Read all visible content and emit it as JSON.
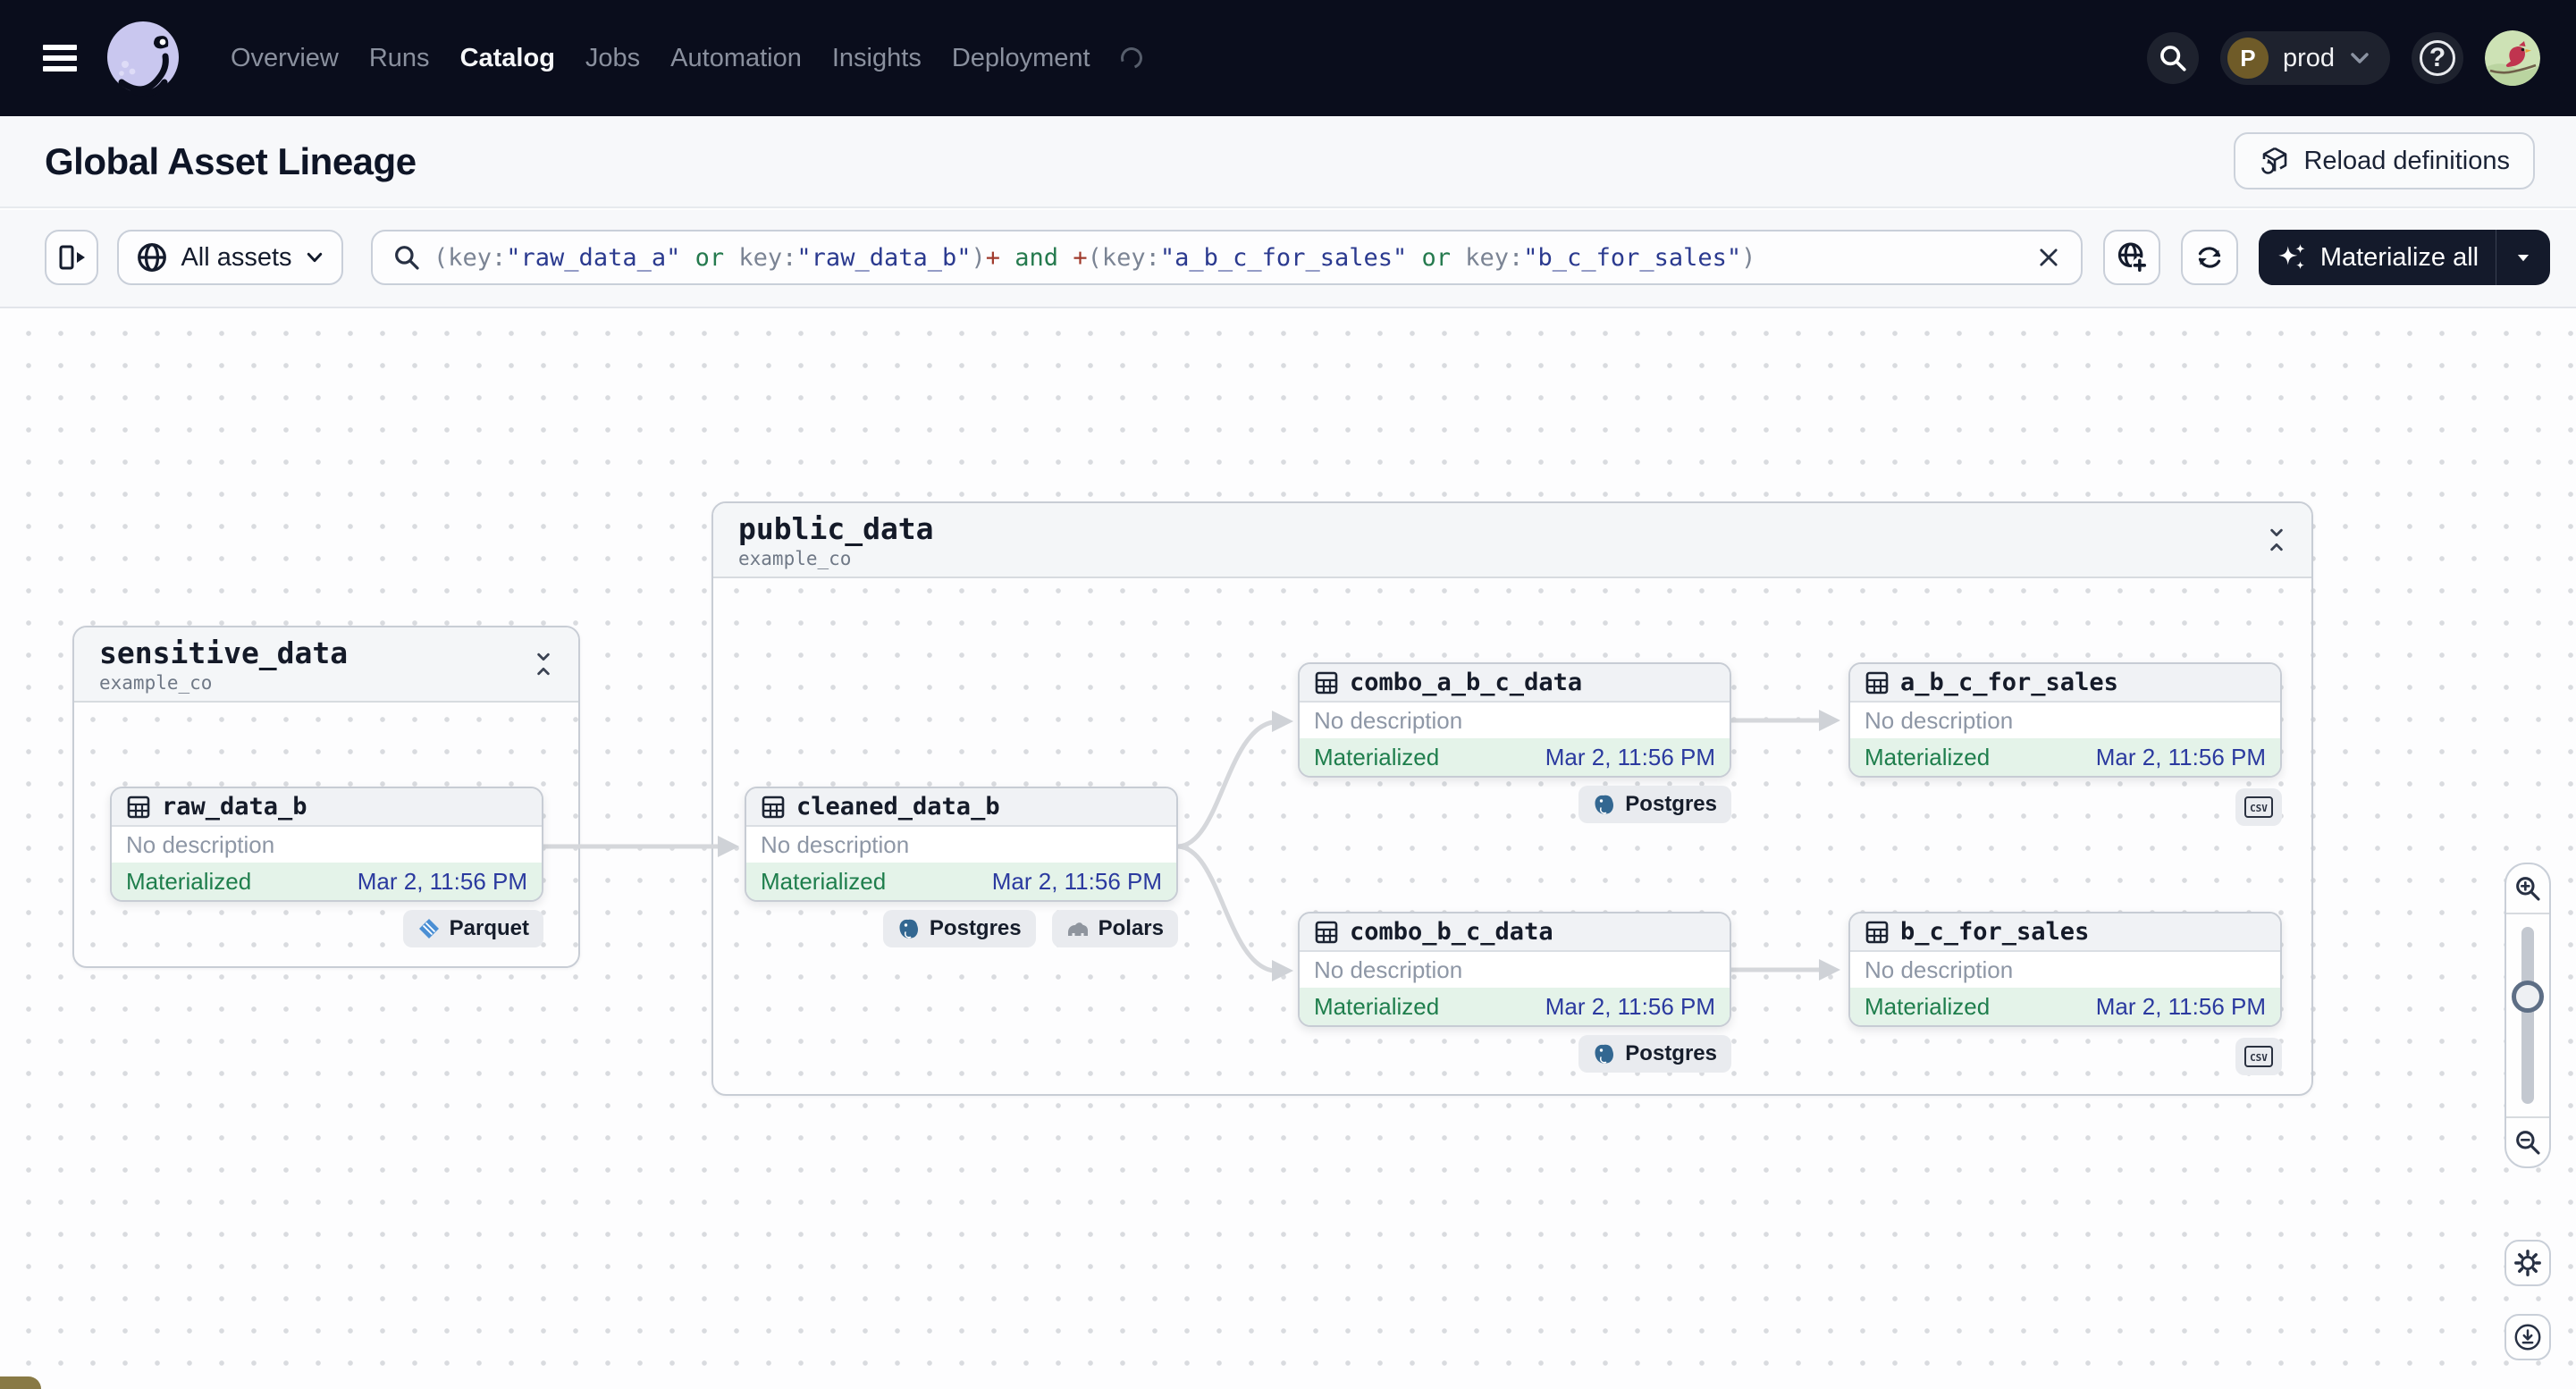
{
  "nav": {
    "items": [
      {
        "label": "Overview",
        "active": false
      },
      {
        "label": "Runs",
        "active": false
      },
      {
        "label": "Catalog",
        "active": true
      },
      {
        "label": "Jobs",
        "active": false
      },
      {
        "label": "Automation",
        "active": false
      },
      {
        "label": "Insights",
        "active": false
      },
      {
        "label": "Deployment",
        "active": false
      }
    ],
    "workspace": {
      "initial": "P",
      "name": "prod"
    },
    "help_glyph": "?"
  },
  "header": {
    "title": "Global Asset Lineage",
    "reload_button": "Reload definitions"
  },
  "toolbar": {
    "scope": {
      "label": "All assets"
    },
    "search": {
      "segments": [
        {
          "t": "(key:",
          "c": "q-p"
        },
        {
          "t": "\"raw_data_a\"",
          "c": "q-s"
        },
        {
          "t": " ",
          "c": "q-p"
        },
        {
          "t": "or",
          "c": "q-o"
        },
        {
          "t": " key:",
          "c": "q-p"
        },
        {
          "t": "\"raw_data_b\"",
          "c": "q-s"
        },
        {
          "t": ")",
          "c": "q-p"
        },
        {
          "t": "+",
          "c": "q-m"
        },
        {
          "t": " ",
          "c": "q-p"
        },
        {
          "t": "and",
          "c": "q-o"
        },
        {
          "t": " ",
          "c": "q-p"
        },
        {
          "t": "+",
          "c": "q-m"
        },
        {
          "t": "(key:",
          "c": "q-p"
        },
        {
          "t": "\"a_b_c_for_sales\"",
          "c": "q-s"
        },
        {
          "t": " ",
          "c": "q-p"
        },
        {
          "t": "or",
          "c": "q-o"
        },
        {
          "t": " key:",
          "c": "q-p"
        },
        {
          "t": "\"b_c_for_sales\"",
          "c": "q-s"
        },
        {
          "t": ")",
          "c": "q-p"
        }
      ]
    },
    "materialize": {
      "label": "Materialize all"
    }
  },
  "graph": {
    "groups": [
      {
        "name": "sensitive_data",
        "repo": "example_co"
      },
      {
        "name": "public_data",
        "repo": "example_co"
      }
    ],
    "nodes": [
      {
        "title": "raw_data_b",
        "description": "No description",
        "status": "Materialized",
        "timestamp": "Mar 2, 11:56 PM",
        "badges": [
          {
            "label": "Parquet"
          }
        ]
      },
      {
        "title": "cleaned_data_b",
        "description": "No description",
        "status": "Materialized",
        "timestamp": "Mar 2, 11:56 PM",
        "badges": [
          {
            "label": "Postgres"
          },
          {
            "label": "Polars"
          }
        ]
      },
      {
        "title": "combo_a_b_c_data",
        "description": "No description",
        "status": "Materialized",
        "timestamp": "Mar 2, 11:56 PM",
        "badges": [
          {
            "label": "Postgres"
          }
        ]
      },
      {
        "title": "a_b_c_for_sales",
        "description": "No description",
        "status": "Materialized",
        "timestamp": "Mar 2, 11:56 PM",
        "badges": [
          {
            "label": "CSV"
          }
        ]
      },
      {
        "title": "combo_b_c_data",
        "description": "No description",
        "status": "Materialized",
        "timestamp": "Mar 2, 11:56 PM",
        "badges": [
          {
            "label": "Postgres"
          }
        ]
      },
      {
        "title": "b_c_for_sales",
        "description": "No description",
        "status": "Materialized",
        "timestamp": "Mar 2, 11:56 PM",
        "badges": [
          {
            "label": "CSV"
          }
        ]
      }
    ]
  },
  "colors": {
    "nav_bg": "#0a0d1c",
    "materialized_green": "#1e7e4c",
    "timestamp_navy": "#2b3a9f",
    "query_string_blue": "#2b3a8f",
    "query_operator_green": "#257a4e",
    "query_plus_red": "#a03a2c",
    "edge_gray": "#d5d7db"
  }
}
